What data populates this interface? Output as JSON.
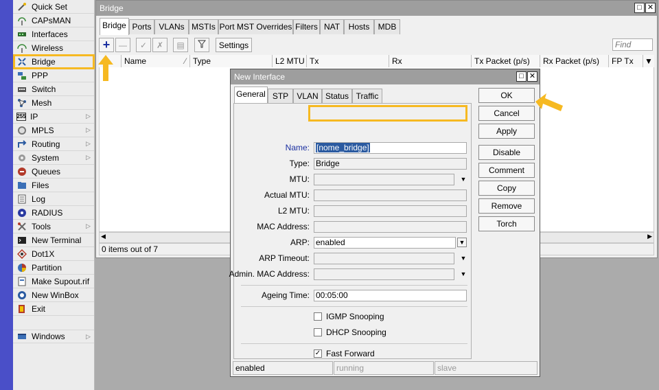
{
  "sidebar": {
    "items": [
      {
        "label": "Quick Set",
        "icon": "wand-icon",
        "arrow": false
      },
      {
        "label": "CAPsMAN",
        "icon": "antenna-icon",
        "arrow": false
      },
      {
        "label": "Interfaces",
        "icon": "interfaces-icon",
        "arrow": false
      },
      {
        "label": "Wireless",
        "icon": "wireless-icon",
        "arrow": false
      },
      {
        "label": "Bridge",
        "icon": "bridge-icon",
        "arrow": false
      },
      {
        "label": "PPP",
        "icon": "ppp-icon",
        "arrow": false
      },
      {
        "label": "Switch",
        "icon": "switch-icon",
        "arrow": false
      },
      {
        "label": "Mesh",
        "icon": "mesh-icon",
        "arrow": false
      },
      {
        "label": "IP",
        "icon": "ip-icon",
        "arrow": true
      },
      {
        "label": "MPLS",
        "icon": "mpls-icon",
        "arrow": true
      },
      {
        "label": "Routing",
        "icon": "routing-icon",
        "arrow": true
      },
      {
        "label": "System",
        "icon": "gear-icon",
        "arrow": true
      },
      {
        "label": "Queues",
        "icon": "queues-icon",
        "arrow": false
      },
      {
        "label": "Files",
        "icon": "folder-icon",
        "arrow": false
      },
      {
        "label": "Log",
        "icon": "log-icon",
        "arrow": false
      },
      {
        "label": "RADIUS",
        "icon": "radius-icon",
        "arrow": false
      },
      {
        "label": "Tools",
        "icon": "tools-icon",
        "arrow": true
      },
      {
        "label": "New Terminal",
        "icon": "terminal-icon",
        "arrow": false
      },
      {
        "label": "Dot1X",
        "icon": "dot1x-icon",
        "arrow": false
      },
      {
        "label": "Partition",
        "icon": "partition-icon",
        "arrow": false
      },
      {
        "label": "Make Supout.rif",
        "icon": "supout-icon",
        "arrow": false
      },
      {
        "label": "New WinBox",
        "icon": "winbox-icon",
        "arrow": false
      },
      {
        "label": "Exit",
        "icon": "exit-icon",
        "arrow": false
      }
    ],
    "windows_label": "Windows"
  },
  "bridge_window": {
    "title": "Bridge",
    "tabs": [
      "Bridge",
      "Ports",
      "VLANs",
      "MSTIs",
      "Port MST Overrides",
      "Filters",
      "NAT",
      "Hosts",
      "MDB"
    ],
    "settings_label": "Settings",
    "find_placeholder": "Find",
    "columns": [
      "Name",
      "Type",
      "L2 MTU",
      "Tx",
      "Rx",
      "Tx Packet (p/s)",
      "Rx Packet (p/s)",
      "FP Tx"
    ],
    "status": "0 items out of 7"
  },
  "dialog": {
    "title": "New Interface",
    "tabs": [
      "General",
      "STP",
      "VLAN",
      "Status",
      "Traffic"
    ],
    "fields": {
      "name": {
        "label": "Name:",
        "value": "[nome_bridge]"
      },
      "type": {
        "label": "Type:",
        "value": "Bridge"
      },
      "mtu": {
        "label": "MTU:",
        "value": ""
      },
      "actual_mtu": {
        "label": "Actual MTU:",
        "value": ""
      },
      "l2_mtu": {
        "label": "L2 MTU:",
        "value": ""
      },
      "mac_address": {
        "label": "MAC Address:",
        "value": ""
      },
      "arp": {
        "label": "ARP:",
        "value": "enabled"
      },
      "arp_timeout": {
        "label": "ARP Timeout:",
        "value": ""
      },
      "admin_mac": {
        "label": "Admin. MAC Address:",
        "value": ""
      },
      "ageing_time": {
        "label": "Ageing Time:",
        "value": "00:05:00"
      }
    },
    "checkboxes": [
      {
        "label": "IGMP Snooping",
        "checked": false
      },
      {
        "label": "DHCP Snooping",
        "checked": false
      },
      {
        "label": "Fast Forward",
        "checked": true
      }
    ],
    "buttons": [
      "OK",
      "Cancel",
      "Apply",
      "Disable",
      "Comment",
      "Copy",
      "Remove",
      "Torch"
    ],
    "status": [
      "enabled",
      "running",
      "slave"
    ]
  },
  "colors": {
    "highlight": "#f6b921",
    "strip": "#4a4fc8",
    "titlebar": "#9e9e9e"
  }
}
